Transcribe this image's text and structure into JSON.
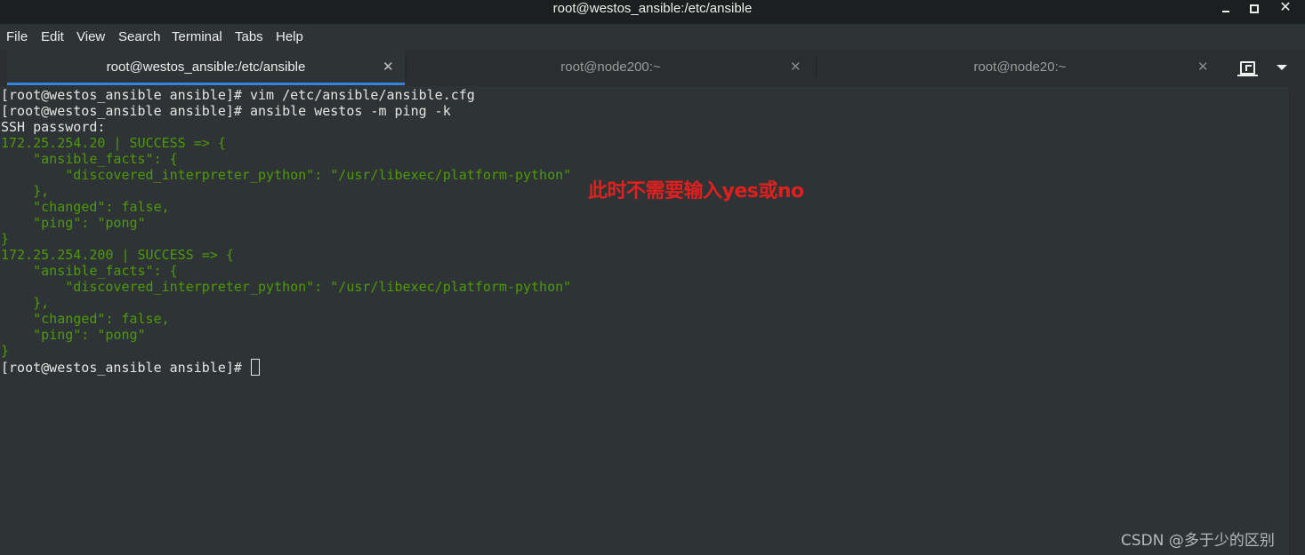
{
  "window": {
    "title": "root@westos_ansible:/etc/ansible",
    "close_glyph": "✕"
  },
  "menu": [
    {
      "label": "File"
    },
    {
      "label": "Edit"
    },
    {
      "label": "View"
    },
    {
      "label": "Search"
    },
    {
      "label": "Terminal"
    },
    {
      "label": "Tabs"
    },
    {
      "label": "Help"
    }
  ],
  "tabs": [
    {
      "label": "root@westos_ansible:/etc/ansible",
      "active": true,
      "close": "✕"
    },
    {
      "label": "root@node200:~",
      "active": false,
      "close": "✕"
    },
    {
      "label": "root@node20:~",
      "active": false,
      "close": "✕"
    }
  ],
  "tab_toolbar": {
    "new_tab_icon": "new-tab-icon",
    "menu_icon": "chevron-down-icon"
  },
  "terminal": {
    "colors": {
      "text": "#e6e6e2",
      "json_output": "#4e9a06",
      "background": "#2e3436",
      "tab_accent": "#3584e4"
    },
    "lines": [
      {
        "text": "[root@westos_ansible ansible]# vim /etc/ansible/ansible.cfg",
        "color": "white"
      },
      {
        "text": "[root@westos_ansible ansible]# ansible westos -m ping -k",
        "color": "white"
      },
      {
        "text": "SSH password:",
        "color": "white"
      },
      {
        "text": "172.25.254.20 | SUCCESS => {",
        "color": "green"
      },
      {
        "text": "    \"ansible_facts\": {",
        "color": "green"
      },
      {
        "text": "        \"discovered_interpreter_python\": \"/usr/libexec/platform-python\"",
        "color": "green"
      },
      {
        "text": "    },",
        "color": "green"
      },
      {
        "text": "    \"changed\": false,",
        "color": "green"
      },
      {
        "text": "    \"ping\": \"pong\"",
        "color": "green"
      },
      {
        "text": "}",
        "color": "green"
      },
      {
        "text": "172.25.254.200 | SUCCESS => {",
        "color": "green"
      },
      {
        "text": "    \"ansible_facts\": {",
        "color": "green"
      },
      {
        "text": "        \"discovered_interpreter_python\": \"/usr/libexec/platform-python\"",
        "color": "green"
      },
      {
        "text": "    },",
        "color": "green"
      },
      {
        "text": "    \"changed\": false,",
        "color": "green"
      },
      {
        "text": "    \"ping\": \"pong\"",
        "color": "green"
      },
      {
        "text": "}",
        "color": "green"
      }
    ],
    "prompt": "[root@westos_ansible ansible]# "
  },
  "annotation": {
    "text": "此时不需要输入yes或no",
    "color": "#e0201e"
  },
  "watermark": {
    "text": "CSDN @多于少的区别"
  }
}
